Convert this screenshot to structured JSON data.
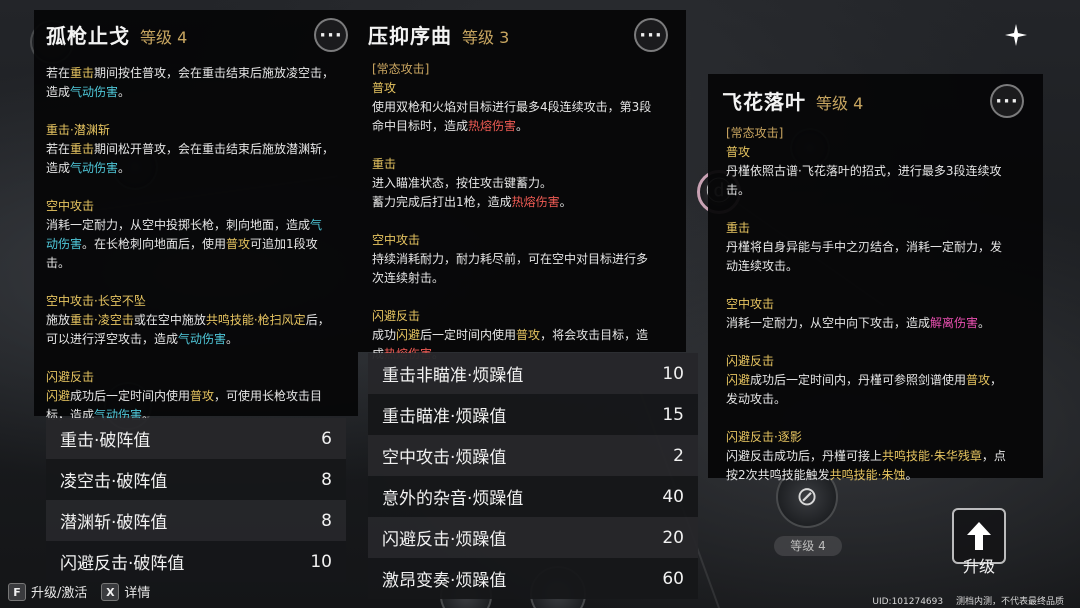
{
  "cards": {
    "left": {
      "title": "孤枪止戈",
      "level": "等级 4",
      "blocks": [
        {
          "lines": [
            [
              {
                "t": "若在"
              },
              {
                "t": "重击",
                "c": "hl-gold"
              },
              {
                "t": "期间按住普攻，会在重击结束后施放凌空击，"
              }
            ],
            [
              {
                "t": "造成"
              },
              {
                "t": "气动伤害",
                "c": "hl-cyan"
              },
              {
                "t": "。"
              }
            ]
          ]
        },
        {
          "heading": "重击·潜渊斩",
          "lines": [
            [
              {
                "t": "若在"
              },
              {
                "t": "重击",
                "c": "hl-gold"
              },
              {
                "t": "期间松开普攻，会在重击结束后施放潜渊斩，"
              }
            ],
            [
              {
                "t": "造成"
              },
              {
                "t": "气动伤害",
                "c": "hl-cyan"
              },
              {
                "t": "。"
              }
            ]
          ]
        },
        {
          "heading": "空中攻击",
          "lines": [
            [
              {
                "t": "消耗一定耐力，从空中投掷长枪，刺向地面，造成"
              },
              {
                "t": "气",
                "c": "hl-cyan"
              }
            ],
            [
              {
                "t": "动伤害",
                "c": "hl-cyan"
              },
              {
                "t": "。在长枪刺向地面后，使用"
              },
              {
                "t": "普攻",
                "c": "hl-gold"
              },
              {
                "t": "可追加1段攻"
              }
            ],
            [
              {
                "t": "击。"
              }
            ]
          ]
        },
        {
          "heading": "空中攻击·长空不坠",
          "lines": [
            [
              {
                "t": "施放"
              },
              {
                "t": "重击·凌空击",
                "c": "hl-gold"
              },
              {
                "t": "或在空中施放"
              },
              {
                "t": "共鸣技能·枪扫风定",
                "c": "hl-gold"
              },
              {
                "t": "后，"
              }
            ],
            [
              {
                "t": "可以进行浮空攻击，造成"
              },
              {
                "t": "气动伤害",
                "c": "hl-cyan"
              },
              {
                "t": "。"
              }
            ]
          ]
        },
        {
          "heading": "闪避反击",
          "lines": [
            [
              {
                "t": "闪避",
                "c": "hl-gold"
              },
              {
                "t": "成功后一定时间内使用"
              },
              {
                "t": "普攻",
                "c": "hl-gold"
              },
              {
                "t": "，可使用长枪攻击目"
              }
            ],
            [
              {
                "t": "标，造成"
              },
              {
                "t": "气动伤害",
                "c": "hl-cyan"
              },
              {
                "t": "。"
              }
            ]
          ]
        }
      ],
      "stats": [
        {
          "label": "重击·破阵值",
          "value": "6"
        },
        {
          "label": "凌空击·破阵值",
          "value": "8"
        },
        {
          "label": "潜渊斩·破阵值",
          "value": "8"
        },
        {
          "label": "闪避反击·破阵值",
          "value": "10"
        }
      ]
    },
    "middle": {
      "title": "压抑序曲",
      "level": "等级 3",
      "category": "[常态攻击]",
      "blocks": [
        {
          "heading": "普攻",
          "lines": [
            [
              {
                "t": "使用双枪和火焰对目标进行最多4段连续攻击，第3段"
              }
            ],
            [
              {
                "t": "命中目标时，造成"
              },
              {
                "t": "热熔伤害",
                "c": "hl-red"
              },
              {
                "t": "。"
              }
            ]
          ]
        },
        {
          "heading": "重击",
          "lines": [
            [
              {
                "t": "进入瞄准状态，按住攻击键蓄力。"
              }
            ],
            [
              {
                "t": "蓄力完成后打出1枪，造成"
              },
              {
                "t": "热熔伤害",
                "c": "hl-red"
              },
              {
                "t": "。"
              }
            ]
          ]
        },
        {
          "heading": "空中攻击",
          "lines": [
            [
              {
                "t": "持续消耗耐力，耐力耗尽前，可在空中对目标进行多"
              }
            ],
            [
              {
                "t": "次连续射击。"
              }
            ]
          ]
        },
        {
          "heading": "闪避反击",
          "lines": [
            [
              {
                "t": "成功"
              },
              {
                "t": "闪避",
                "c": "hl-gold"
              },
              {
                "t": "后一定时间内使用"
              },
              {
                "t": "普攻",
                "c": "hl-gold"
              },
              {
                "t": "，将会攻击目标，造"
              }
            ],
            [
              {
                "t": "成"
              },
              {
                "t": "热熔伤害",
                "c": "hl-red"
              },
              {
                "t": "。"
              }
            ]
          ]
        }
      ],
      "stats": [
        {
          "label": "重击非瞄准·烦躁值",
          "value": "10"
        },
        {
          "label": "重击瞄准·烦躁值",
          "value": "15"
        },
        {
          "label": "空中攻击·烦躁值",
          "value": "2"
        },
        {
          "label": "意外的杂音·烦躁值",
          "value": "40"
        },
        {
          "label": "闪避反击·烦躁值",
          "value": "20"
        },
        {
          "label": "激昂变奏·烦躁值",
          "value": "60"
        }
      ]
    },
    "right": {
      "title": "飞花落叶",
      "level": "等级 4",
      "category": "[常态攻击]",
      "blocks": [
        {
          "heading": "普攻",
          "lines": [
            [
              {
                "t": "丹槿依照古谱·飞花落叶的招式，进行最多3段连续攻"
              }
            ],
            [
              {
                "t": "击。"
              }
            ]
          ]
        },
        {
          "heading": "重击",
          "lines": [
            [
              {
                "t": "丹槿将自身异能与手中之刃结合，消耗一定耐力，发"
              }
            ],
            [
              {
                "t": "动连续攻击。"
              }
            ]
          ]
        },
        {
          "heading": "空中攻击",
          "lines": [
            [
              {
                "t": "消耗一定耐力，从空中向下攻击，造成"
              },
              {
                "t": "解离伤害",
                "c": "hl-pink"
              },
              {
                "t": "。"
              }
            ]
          ]
        },
        {
          "heading": "闪避反击",
          "lines": [
            [
              {
                "t": "闪避",
                "c": "hl-gold"
              },
              {
                "t": "成功后一定时间内，丹槿可参照剑谱使用"
              },
              {
                "t": "普攻",
                "c": "hl-gold"
              },
              {
                "t": "，"
              }
            ],
            [
              {
                "t": "发动攻击。"
              }
            ]
          ]
        },
        {
          "heading": "闪避反击·逐影",
          "lines": [
            [
              {
                "t": "闪避反击成功后，丹槿可接上"
              },
              {
                "t": "共鸣技能·朱华残章",
                "c": "hl-gold"
              },
              {
                "t": "，点"
              }
            ],
            [
              {
                "t": "按2次共鸣技能触发"
              },
              {
                "t": "共鸣技能·朱蚀",
                "c": "hl-gold"
              },
              {
                "t": "。"
              }
            ]
          ]
        }
      ]
    }
  },
  "more_icon": "···",
  "level_badge": "等级 4",
  "upgrade": {
    "label": "升级",
    "icon": "arrow-up-icon"
  },
  "hints": [
    {
      "key": "F",
      "label": "升级/激活"
    },
    {
      "key": "X",
      "label": "详情"
    }
  ],
  "footer": {
    "uid": "UID:101274693",
    "note": "测档内测，不代表最终品质"
  }
}
